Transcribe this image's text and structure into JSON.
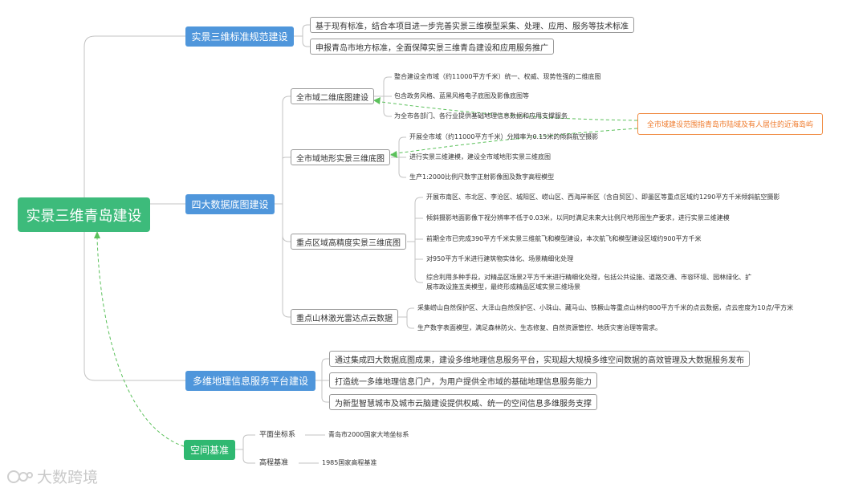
{
  "root": {
    "label": "实景三维青岛建设"
  },
  "branches": [
    {
      "label": "实景三维标准规范建设",
      "items": [
        "基于现有标准，结合本项目进一步完善实景三维模型采集、处理、应用、服务等技术标准",
        "申报青岛市地方标准，全面保障实景三维青岛建设和应用服务推广"
      ]
    },
    {
      "label": "四大数据底图建设",
      "subs": [
        {
          "label": "全市域二维底图建设",
          "items": [
            "整合建设全市域（约11000平方千米）统一、权威、现势性强的二维底图",
            "包含政务风格、蓝黑风格电子底图及影像底图等",
            "为全市各部门、各行业提供基础地理信息数据和应用支撑服务"
          ]
        },
        {
          "label": "全市域地形实景三维底图",
          "items": [
            "开展全市域（约11000平方千米）分辨率为0.15米的倾斜航空摄影",
            "进行实景三维建模，建设全市域地形实景三维底图",
            "生产1:2000比例尺数字正射影像图及数字高程模型"
          ]
        },
        {
          "label": "重点区域高精度实景三维底图",
          "items": [
            "开展市南区、市北区、李沧区、城阳区、崂山区、西海岸新区（含自贸区）、即墨区等重点区域约1290平方千米倾斜航空摄影",
            "倾斜摄影地面影像下视分辨率不低于0.03米，以同时满足未来大比例尺地形图生产要求，进行实景三维建模",
            "前期全市已完成390平方千米实景三维航飞和模型建设，本次航飞和模型建设区域约900平方千米",
            "对950平方千米进行建筑物实体化、场景精细化处理",
            "综合利用多种手段，对精品区场景2平方千米进行精细化处理，包括公共设施、道路交通、市容环境、园林绿化、扩展市政设施五类模型，最终形成精品区域实景三维场景"
          ]
        },
        {
          "label": "重点山林激光雷达点云数据",
          "items": [
            "采集崂山自然保护区、大泽山自然保护区、小珠山、藏马山、铁橛山等重点山林约800平方千米的点云数据，点云密度为10点/平方米",
            "生产数字表面模型，满足森林防火、生态修复、自然资源管控、地质灾害治理等需求。"
          ]
        }
      ]
    },
    {
      "label": "多维地理信息服务平台建设",
      "items": [
        "通过集成四大数据底图成果，建设多维地理信息服务平台，实现超大规模多维空间数据的高效管理及大数据服务发布",
        "打造统一多维地理信息门户，为用户提供全市域的基础地理信息服务能力",
        "为新型智慧城市及城市云脑建设提供权威、统一的空间信息多维服务支撑"
      ]
    },
    {
      "label": "空间基准",
      "subs": [
        {
          "label": "平面坐标系",
          "value": "青岛市2000国家大地坐标系"
        },
        {
          "label": "高程基准",
          "value": "1985国家高程基准"
        }
      ]
    }
  ],
  "note": "全市域建设范围指青岛市陆域及有人居住的近海岛屿",
  "watermark": "大数跨境",
  "colors": {
    "root": "#3dbb7b",
    "branch": "#4f96db",
    "branch_green": "#2fb871",
    "connector": "#c0c0c0",
    "dashed": "#4cbf4c",
    "note": "#ef7a2b"
  }
}
